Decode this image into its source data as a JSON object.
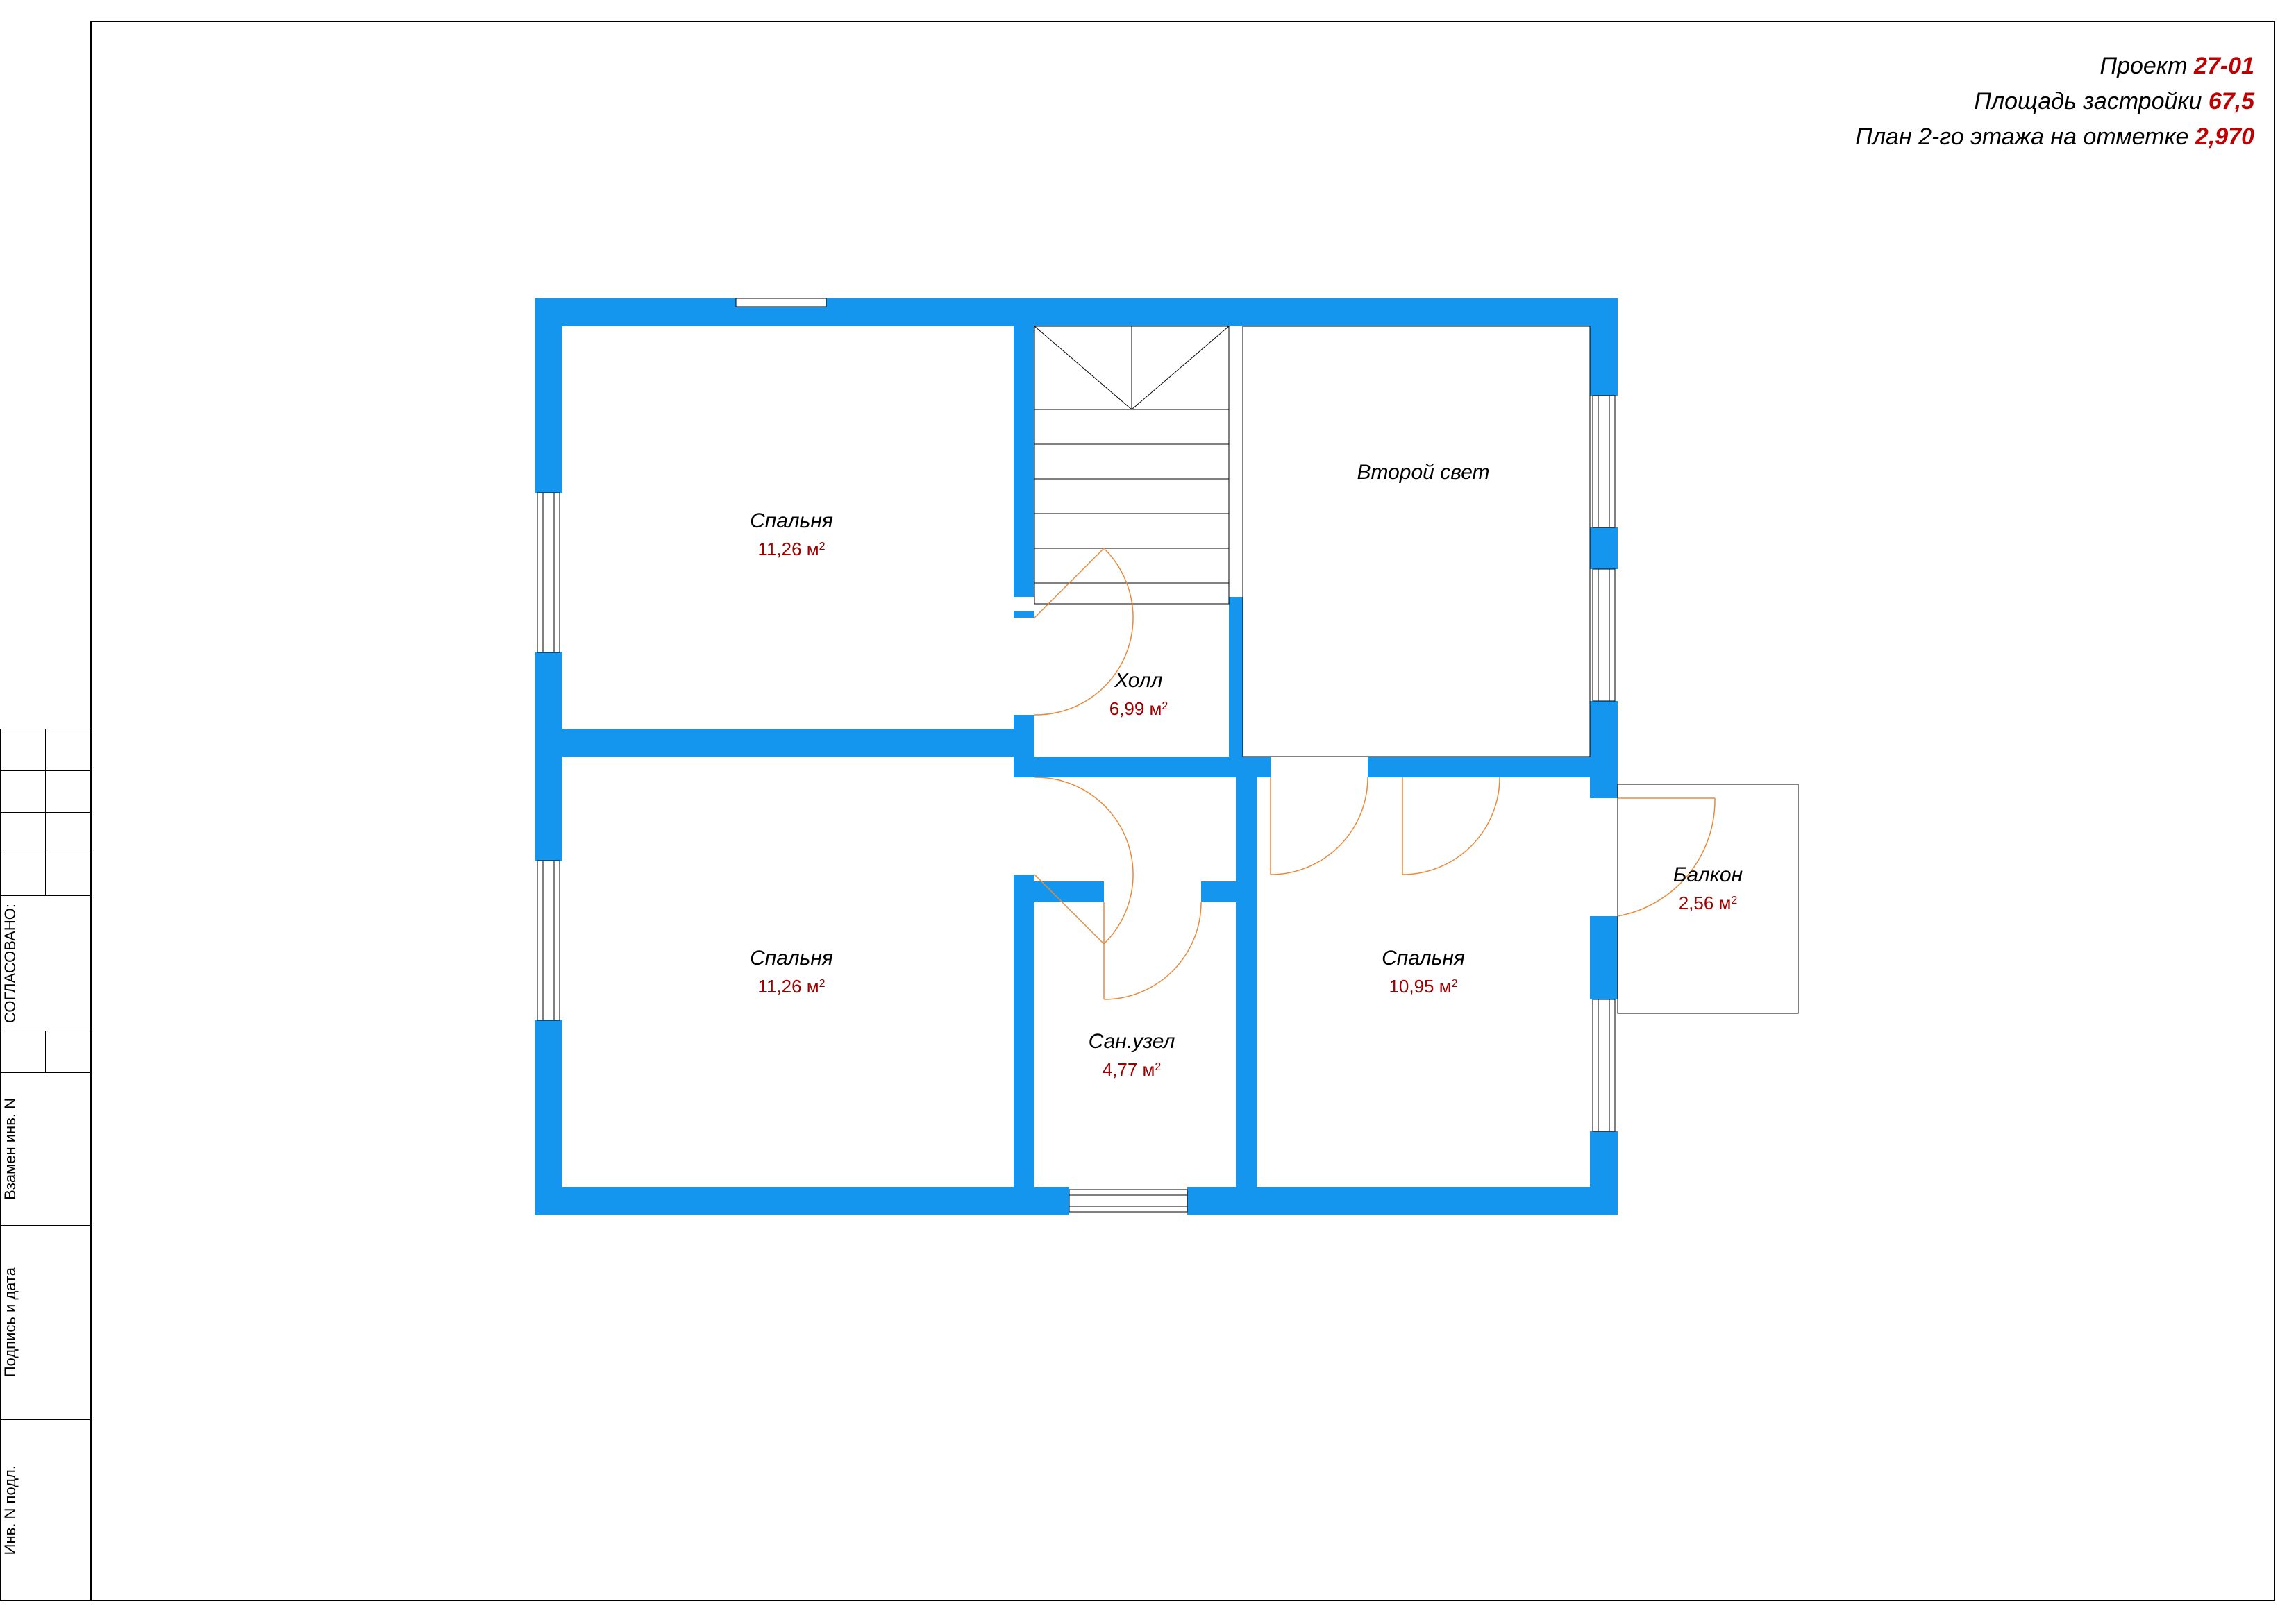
{
  "header": {
    "project_label": "Проект",
    "project_value": "27-01",
    "area_label": "Площадь застройки",
    "area_value": "67,5",
    "plan_label": "План 2-го этажа на отметке",
    "plan_value": "2,970"
  },
  "side": {
    "agreed": "СОГЛАСОВАНО:",
    "inv_replace": "Взамен инв. N",
    "sign_date": "Подпись и дата",
    "inv_orig": "Инв. N подл."
  },
  "rooms": {
    "bedroom1": {
      "name": "Спальня",
      "area": "11,26 м",
      "sup": "2"
    },
    "bedroom2": {
      "name": "Спальня",
      "area": "11,26 м",
      "sup": "2"
    },
    "bedroom3": {
      "name": "Спальня",
      "area": "10,95 м",
      "sup": "2"
    },
    "hall": {
      "name": "Холл",
      "area": "6,99 м",
      "sup": "2"
    },
    "bath": {
      "name": "Сан.узел",
      "area": "4,77 м",
      "sup": "2"
    },
    "balcony": {
      "name": "Балкон",
      "area": "2,56 м",
      "sup": "2"
    },
    "void": {
      "name": "Второй свет"
    }
  },
  "colors": {
    "wall": "#1496ef",
    "accent_red": "#c00000",
    "door": "#e88a3c"
  }
}
